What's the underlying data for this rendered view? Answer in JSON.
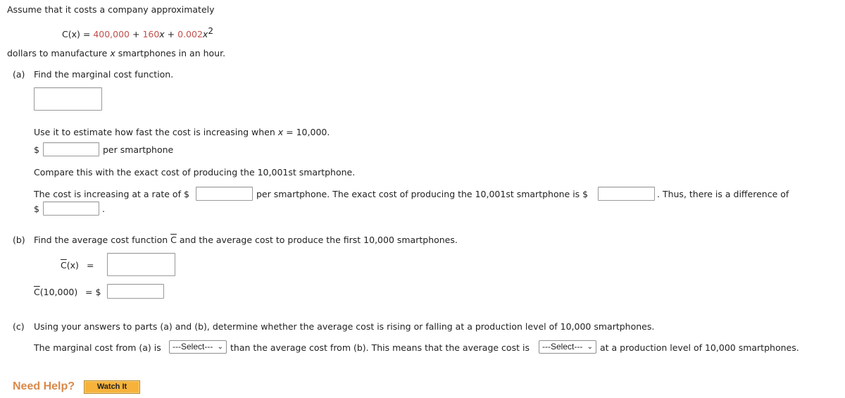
{
  "intro": {
    "line1": "Assume that it costs a company approximately",
    "formula": {
      "lhs": "C(x)",
      "eq": " = ",
      "term1": "400,000",
      "plus1": " + ",
      "term2": "160",
      "var2": "x",
      "plus2": " + ",
      "term3": "0.002",
      "var3": "x",
      "exp3": "2"
    },
    "line2_pre": "dollars to manufacture ",
    "line2_var": "x",
    "line2_post": " smartphones in an hour."
  },
  "part_a": {
    "label": "(a)",
    "prompt": "Find the marginal cost function.",
    "marginal_fn_value": "",
    "estimate_prompt_pre": "Use it to estimate how fast the cost is increasing when ",
    "estimate_prompt_var": "x",
    "estimate_prompt_post": " = 10,000.",
    "dollar": "$",
    "estimate_value": "",
    "estimate_unit": "per smartphone",
    "compare_prompt": "Compare this with the exact cost of producing the 10,001st smartphone.",
    "sentence_1": "The cost is increasing at a rate of $",
    "rate_value": "",
    "sentence_2": "per smartphone. The exact cost of producing the 10,001st smartphone is $",
    "exact_value": "",
    "sentence_3": ". Thus, there is a difference of",
    "dollar2": "$",
    "difference_value": "",
    "period": "."
  },
  "part_b": {
    "label": "(b)",
    "prompt_pre": "Find the average cost function ",
    "prompt_sym": "C",
    "prompt_post": " and the average cost to produce the first 10,000 smartphones.",
    "avg_fn_label_sym": "C",
    "avg_fn_label_rest": "(x)",
    "avg_fn_eq": "=",
    "avg_fn_value": "",
    "avg_cost_label_sym": "C",
    "avg_cost_label_rest": "(10,000)",
    "avg_cost_eq": "= $",
    "avg_cost_value": ""
  },
  "part_c": {
    "label": "(c)",
    "prompt": "Using your answers to parts (a) and (b), determine whether the average cost is rising or falling at a production level of 10,000 smartphones.",
    "sentence_1": "The marginal cost from (a) is",
    "select_1": "---Select---",
    "sentence_2": "than the average cost from (b). This means that the average cost is",
    "select_2": "---Select---",
    "sentence_3": "at a production level of 10,000 smartphones."
  },
  "help": {
    "label": "Need Help?",
    "watch_button": "Watch It"
  }
}
